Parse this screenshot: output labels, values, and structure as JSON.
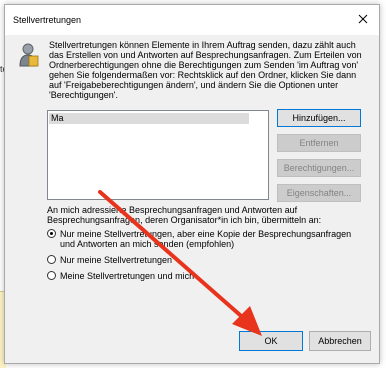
{
  "background": {
    "partial_letter": "te"
  },
  "dialog": {
    "title": "Stellvertretungen",
    "description": "Stellvertretungen können Elemente in Ihrem Auftrag senden, dazu zählt auch das Erstellen von und Antworten auf Besprechungsanfragen. Zum Erteilen von Ordnerberechtigungen ohne die Berechtigungen zum Senden 'im Auftrag von' gehen Sie folgendermaßen vor: Rechtsklick auf den Ordner, klicken Sie dann auf 'Freigabeberechtigungen ändern', und ändern Sie die Optionen unter 'Berechtigungen'.",
    "delegates": [
      "Ma"
    ],
    "buttons": {
      "add": "Hinzufügen...",
      "remove": "Entfernen",
      "permissions": "Berechtigungen...",
      "properties": "Eigenschaften...",
      "ok": "OK",
      "cancel": "Abbrechen"
    },
    "meeting_section_label": "An mich adressierte Besprechungsanfragen und Antworten auf Besprechungsanfragen, deren Organisator*in ich bin, übermitteln an:",
    "radio_options": [
      {
        "label": "Nur meine Stellvertretungen, aber eine Kopie der Besprechungsanfragen und Antworten an mich senden (empfohlen)",
        "checked": true
      },
      {
        "label": "Nur meine Stellvertretungen",
        "checked": false
      },
      {
        "label": "Meine Stellvertretungen und mich",
        "checked": false
      }
    ]
  },
  "colors": {
    "dialog_bg": "#f0f0f0",
    "primary_border": "#0078d7",
    "annotation_arrow": "#e8341c"
  },
  "icons": {
    "close": "close-icon",
    "info": "info-icon"
  }
}
